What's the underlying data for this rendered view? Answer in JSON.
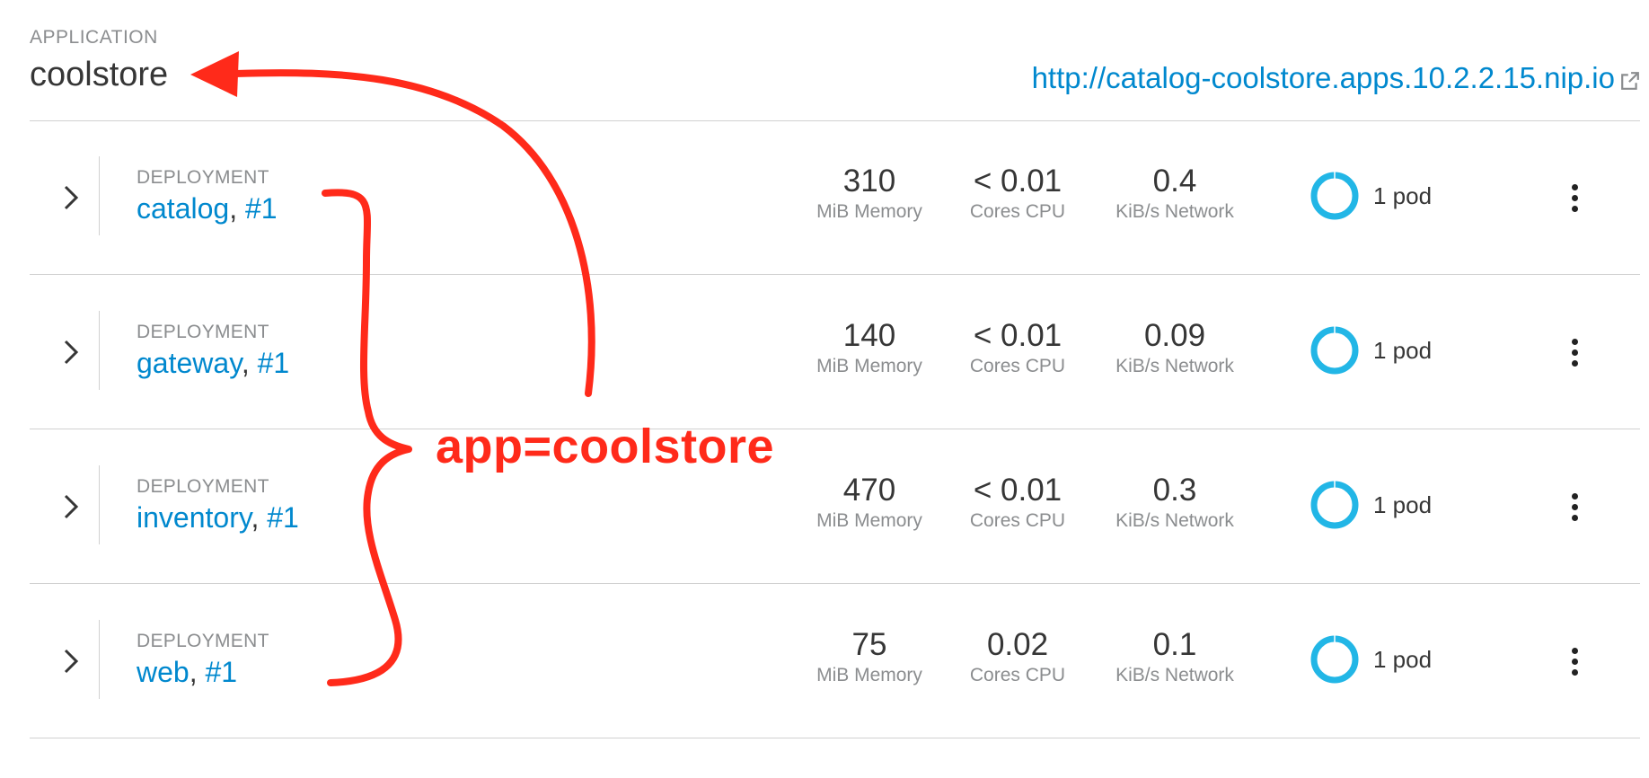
{
  "application": {
    "kicker": "APPLICATION",
    "name": "coolstore",
    "route_url": "http://catalog-coolstore.apps.10.2.2.15.nip.io"
  },
  "deployments": [
    {
      "kind": "DEPLOYMENT",
      "name": "catalog",
      "separator": ", ",
      "revision": "#1",
      "memory": {
        "value": "310",
        "label": "MiB Memory"
      },
      "cpu": {
        "value": "< 0.01",
        "label": "Cores CPU"
      },
      "network": {
        "value": "0.4",
        "label": "KiB/s Network"
      },
      "pods": "1 pod"
    },
    {
      "kind": "DEPLOYMENT",
      "name": "gateway",
      "separator": ", ",
      "revision": "#1",
      "memory": {
        "value": "140",
        "label": "MiB Memory"
      },
      "cpu": {
        "value": "< 0.01",
        "label": "Cores CPU"
      },
      "network": {
        "value": "0.09",
        "label": "KiB/s Network"
      },
      "pods": "1 pod"
    },
    {
      "kind": "DEPLOYMENT",
      "name": "inventory",
      "separator": ", ",
      "revision": "#1",
      "memory": {
        "value": "470",
        "label": "MiB Memory"
      },
      "cpu": {
        "value": "< 0.01",
        "label": "Cores CPU"
      },
      "network": {
        "value": "0.3",
        "label": "KiB/s Network"
      },
      "pods": "1 pod"
    },
    {
      "kind": "DEPLOYMENT",
      "name": "web",
      "separator": ", ",
      "revision": "#1",
      "memory": {
        "value": "75",
        "label": "MiB Memory"
      },
      "cpu": {
        "value": "0.02",
        "label": "Cores CPU"
      },
      "network": {
        "value": "0.1",
        "label": "KiB/s Network"
      },
      "pods": "1 pod"
    }
  ],
  "annotation": {
    "label": "app=coolstore"
  },
  "icons": {
    "expand": "chevron-right-icon",
    "external_link": "external-link-icon",
    "pod_status": "pod-donut-icon",
    "actions": "kebab-menu-icon"
  },
  "colors": {
    "link": "#0088ce",
    "pod_ring": "#22b6e6",
    "annotation": "#ff2a1a"
  }
}
